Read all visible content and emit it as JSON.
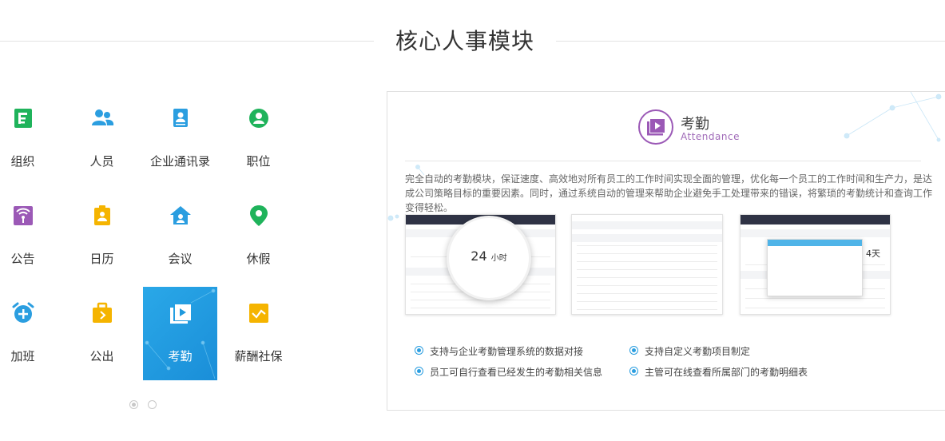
{
  "section": {
    "title": "核心人事模块"
  },
  "modules": [
    {
      "label": "组织",
      "icon": "org-icon",
      "color": "#1fb35b"
    },
    {
      "label": "人员",
      "icon": "people-icon",
      "color": "#2b9ee0"
    },
    {
      "label": "企业通讯录",
      "icon": "contacts-icon",
      "color": "#2b9ee0"
    },
    {
      "label": "职位",
      "icon": "position-icon",
      "color": "#1fb35b"
    },
    {
      "label": "公告",
      "icon": "announcement-icon",
      "color": "#9b59b6"
    },
    {
      "label": "日历",
      "icon": "calendar-icon",
      "color": "#f5b400"
    },
    {
      "label": "会议",
      "icon": "meeting-icon",
      "color": "#2b9ee0"
    },
    {
      "label": "休假",
      "icon": "leave-icon",
      "color": "#1fb35b"
    },
    {
      "label": "加班",
      "icon": "overtime-icon",
      "color": "#2b9ee0"
    },
    {
      "label": "公出",
      "icon": "business-trip-icon",
      "color": "#f5b400"
    },
    {
      "label": "考勤",
      "icon": "attendance-icon",
      "color": "#ffffff",
      "active": true
    },
    {
      "label": "薪酬社保",
      "icon": "payroll-icon",
      "color": "#f5b400"
    }
  ],
  "pagination": {
    "pages": 2,
    "current": 1
  },
  "detail": {
    "title": "考勤",
    "subtitle": "Attendance",
    "icon": "attendance-icon",
    "accent": "#9b59b6",
    "description": "完全自动的考勤模块，保证速度、高效地对所有员工的工作时间实现全面的管理，优化每一个员工的工作时间和生产力，是达成公司策略目标的重要因素。同时，通过系统自动的管理来帮助企业避免手工处理带来的错误，将繁琐的考勤统计和查询工作变得轻松。",
    "screenshots": {
      "magnifier_value": "24",
      "magnifier_unit": "小时",
      "shot3_value": "4天"
    },
    "features": [
      "支持与企业考勤管理系统的数据对接",
      "支持自定义考勤项目制定",
      "员工可自行查看已经发生的考勤相关信息",
      "主管可在线查看所属部门的考勤明细表"
    ]
  }
}
